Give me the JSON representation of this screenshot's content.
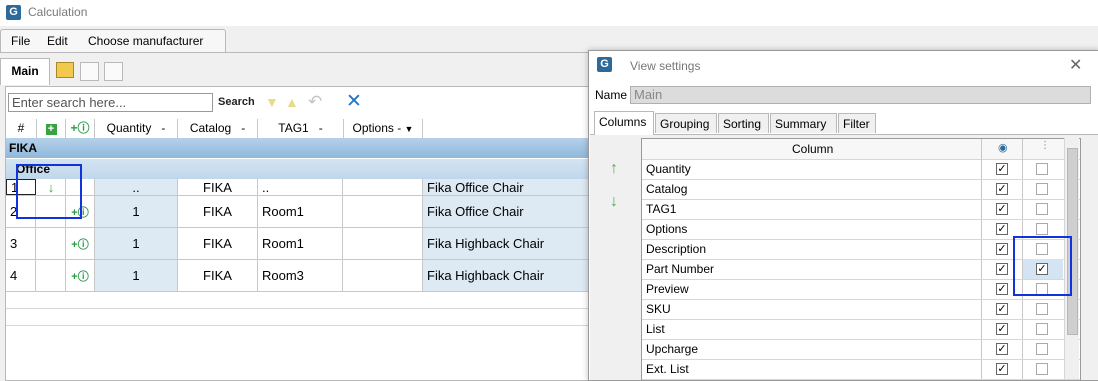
{
  "window": {
    "title": "Calculation"
  },
  "menu": {
    "file": "File",
    "edit": "Edit",
    "choose_manufacturer": "Choose manufacturer"
  },
  "tabs": {
    "main": "Main"
  },
  "search": {
    "placeholder": "Enter search here...",
    "label": "Search"
  },
  "grid": {
    "headers": [
      "#",
      "+",
      "+i",
      "Quantity",
      "Catalog",
      "TAG1",
      "Options"
    ],
    "group": "FIKA",
    "subgroup": "Office",
    "rows": [
      {
        "num": "1",
        "quantity": "..",
        "catalog": "FIKA",
        "tag1": "..",
        "desc": "Fika Office Chair"
      },
      {
        "num": "2",
        "quantity": "1",
        "catalog": "FIKA",
        "tag1": "Room1",
        "desc": "Fika Office Chair"
      },
      {
        "num": "3",
        "quantity": "1",
        "catalog": "FIKA",
        "tag1": "Room1",
        "desc": "Fika Highback Chair"
      },
      {
        "num": "4",
        "quantity": "1",
        "catalog": "FIKA",
        "tag1": "Room3",
        "desc": "Fika Highback Chair"
      }
    ]
  },
  "dialog": {
    "title": "View settings",
    "name_label": "Name",
    "name_value": "Main",
    "tabs": [
      "Columns",
      "Grouping",
      "Sorting",
      "Summary",
      "Filter"
    ],
    "column_header": "Column",
    "columns": [
      {
        "name": "Quantity",
        "visible": true,
        "export": false
      },
      {
        "name": "Catalog",
        "visible": true,
        "export": false
      },
      {
        "name": "TAG1",
        "visible": true,
        "export": false
      },
      {
        "name": "Options",
        "visible": true,
        "export": false
      },
      {
        "name": "Description",
        "visible": true,
        "export": false
      },
      {
        "name": "Part Number",
        "visible": true,
        "export": true
      },
      {
        "name": "Preview",
        "visible": true,
        "export": false
      },
      {
        "name": "SKU",
        "visible": true,
        "export": false
      },
      {
        "name": "List",
        "visible": true,
        "export": false
      },
      {
        "name": "Upcharge",
        "visible": true,
        "export": false
      },
      {
        "name": "Ext. List",
        "visible": true,
        "export": false
      }
    ]
  },
  "colors": {
    "highlight_box": "#1133dd",
    "group_header": "#8fb8dc",
    "arrow": "#4caf50"
  }
}
